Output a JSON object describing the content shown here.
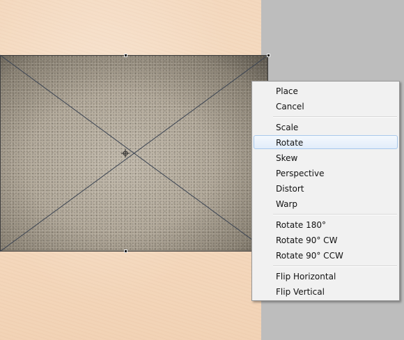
{
  "context_menu": {
    "items": [
      {
        "label": "Place"
      },
      {
        "label": "Cancel"
      },
      {
        "label": "Scale"
      },
      {
        "label": "Rotate",
        "highlighted": true
      },
      {
        "label": "Skew"
      },
      {
        "label": "Perspective"
      },
      {
        "label": "Distort"
      },
      {
        "label": "Warp"
      },
      {
        "label": "Rotate 180°"
      },
      {
        "label": "Rotate 90° CW"
      },
      {
        "label": "Rotate 90° CCW"
      },
      {
        "label": "Flip Horizontal"
      },
      {
        "label": "Flip Vertical"
      }
    ]
  },
  "colors": {
    "paper": "#f5dbc1",
    "pasteboard": "#bdbdbd",
    "menu_background": "#f1f1f1",
    "menu_highlight": "#e1ecfa",
    "menu_highlight_border": "#a8c8ec"
  }
}
